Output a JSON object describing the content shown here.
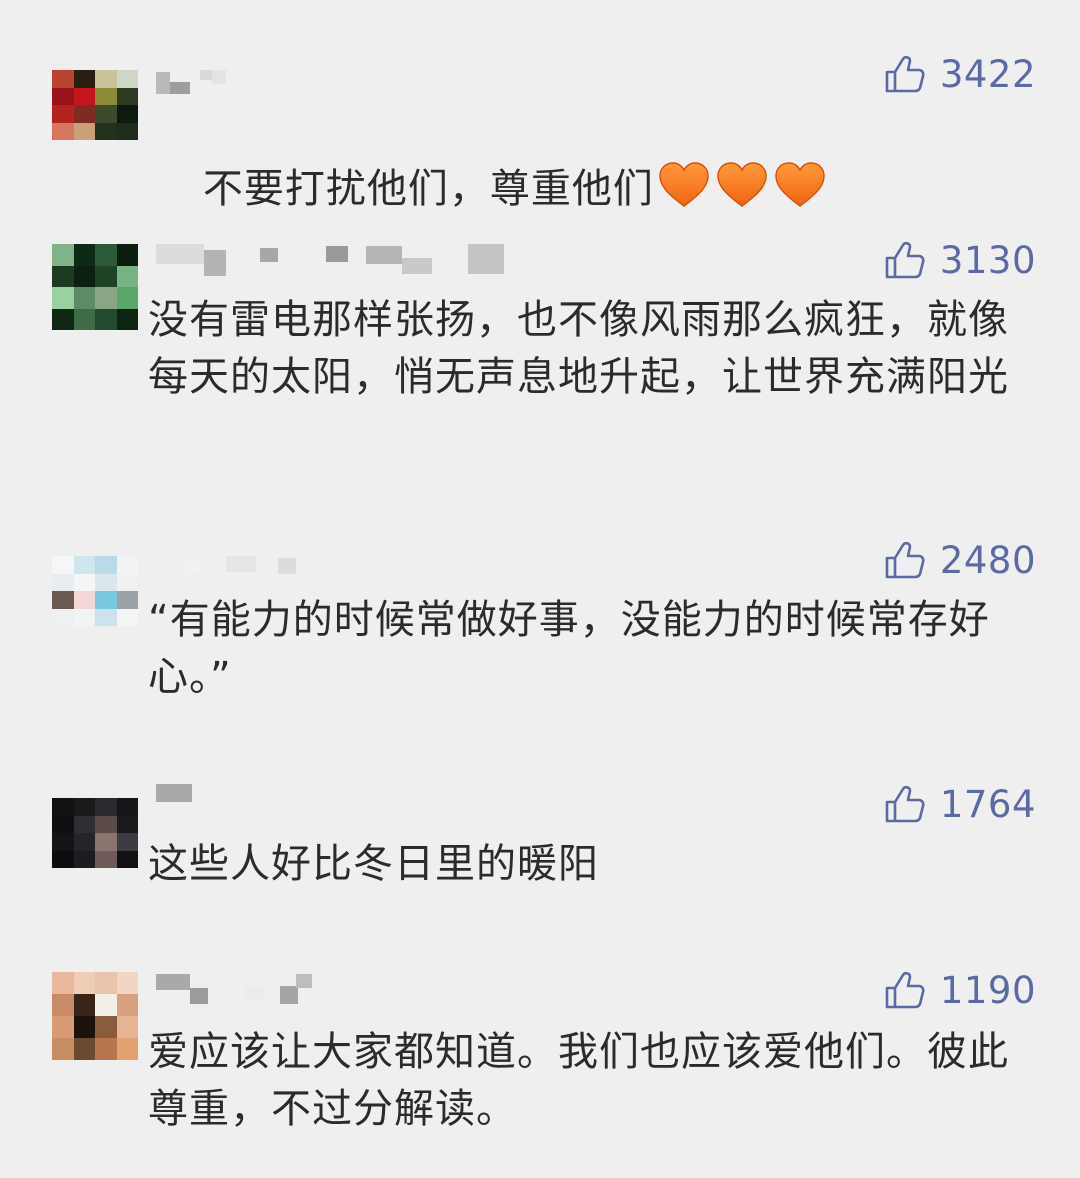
{
  "comments": [
    {
      "text": "不要打扰他们，尊重他们",
      "emoji": [
        "orange-heart-icon",
        "orange-heart-icon",
        "orange-heart-icon"
      ],
      "likes": "3422",
      "avatar_colors": [
        "#b8442f",
        "#2a1d12",
        "#c9c29b",
        "#cfd6c5",
        "#9a1219",
        "#c2151c",
        "#8b8b3a",
        "#2c3a22",
        "#b3241f",
        "#7e2b22",
        "#3e4a2c",
        "#0d1b0e",
        "#d7765e",
        "#c9a07a",
        "#22301c",
        "#1f2c1a"
      ]
    },
    {
      "text": "没有雷电那样张扬，也不像风雨那么疯狂，就像每天的太阳，悄无声息地升起，让世界充满阳光",
      "likes": "3130",
      "avatar_colors": [
        "#7fb489",
        "#0e2a14",
        "#2d5a36",
        "#0a1d0e",
        "#1f3a22",
        "#0c1f10",
        "#1e4226",
        "#78b383",
        "#9ad19f",
        "#5c8b64",
        "#8aa486",
        "#58a769",
        "#0f2814",
        "#3f6b47",
        "#234a2c",
        "#0d2611"
      ]
    },
    {
      "text": "“有能力的时候常做好事，没能力的时候常存好心。”",
      "likes": "2480",
      "avatar_colors": [
        "#f5f6f7",
        "#cfe6ef",
        "#b9dbe8",
        "#f2f3f4",
        "#e8eef0",
        "#f4f5f6",
        "#dbe7ec",
        "#f0f1f2",
        "#6b5a52",
        "#f3d7d7",
        "#77c9e0",
        "#9aa2a8",
        "#eef0f1",
        "#f2f3f3",
        "#cde2ea",
        "#f3f4f5"
      ]
    },
    {
      "text": "这些人好比冬日里的暖阳",
      "likes": "1764",
      "avatar_colors": [
        "#121214",
        "#1a1a1d",
        "#2a2a2e",
        "#161618",
        "#0f0f11",
        "#2d2f33",
        "#5a4a48",
        "#1b1b1e",
        "#141416",
        "#24252a",
        "#8b7470",
        "#3c3d42",
        "#0e0e10",
        "#1c1d20",
        "#6e5b58",
        "#111113"
      ]
    },
    {
      "text": "爱应该让大家都知道。我们也应该爱他们。彼此尊重，不过分解读。",
      "likes": "1190",
      "avatar_colors": [
        "#e8b79c",
        "#f0cdb6",
        "#e9c3ac",
        "#f2d6c3",
        "#c98a67",
        "#3a2418",
        "#f4eee8",
        "#d7a07e",
        "#d89a74",
        "#1c120c",
        "#8a5b3c",
        "#e6b393",
        "#c98d63",
        "#6b4a30",
        "#b7764d",
        "#e3a070"
      ]
    }
  ]
}
